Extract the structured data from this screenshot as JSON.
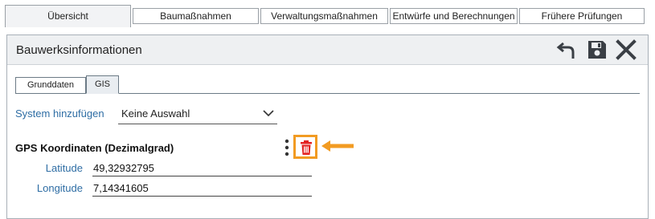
{
  "top_tabs": [
    "Übersicht",
    "Baumaßnahmen",
    "Verwaltungsmaßnahmen",
    "Entwürfe und Berechnungen",
    "Frühere Prüfungen"
  ],
  "panel": {
    "title": "Bauwerksinformationen",
    "actions": {
      "undo_icon": "undo-icon",
      "save_icon": "save-icon",
      "close_icon": "close-icon"
    }
  },
  "inner_tabs": [
    "Grunddaten",
    "GIS"
  ],
  "system": {
    "label": "System hinzufügen",
    "selected": "Keine Auswahl"
  },
  "gps": {
    "title": "GPS Koordinaten (Dezimalgrad)",
    "latitude_label": "Latitude",
    "latitude_value": "49,32932795",
    "longitude_label": "Longitude",
    "longitude_value": "7,14341605"
  },
  "colors": {
    "accent_label": "#2e6da4",
    "highlight": "#f29b22",
    "delete_icon": "#e32222"
  }
}
